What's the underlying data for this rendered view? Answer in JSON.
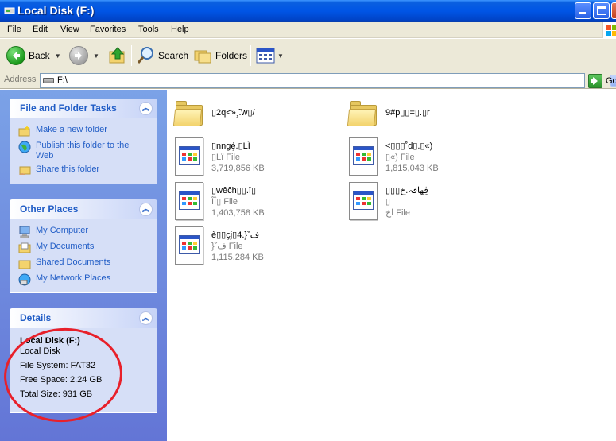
{
  "window": {
    "title": "Local Disk (F:)"
  },
  "menu": [
    "File",
    "Edit",
    "View",
    "Favorites",
    "Tools",
    "Help"
  ],
  "toolbar": {
    "back": "Back",
    "search": "Search",
    "folders": "Folders"
  },
  "address": {
    "label": "Address",
    "value": "F:\\",
    "go": "Go"
  },
  "taskpane": {
    "file_tasks": {
      "title": "File and Folder Tasks",
      "links": [
        {
          "label": "Make a new folder",
          "icon": "new-folder-icon"
        },
        {
          "label": "Publish this folder to the Web",
          "icon": "publish-web-icon"
        },
        {
          "label": "Share this folder",
          "icon": "share-folder-icon"
        }
      ]
    },
    "other_places": {
      "title": "Other Places",
      "links": [
        {
          "label": "My Computer",
          "icon": "my-computer-icon"
        },
        {
          "label": "My Documents",
          "icon": "my-documents-icon"
        },
        {
          "label": "Shared Documents",
          "icon": "shared-documents-icon"
        },
        {
          "label": "My Network Places",
          "icon": "network-places-icon"
        }
      ]
    },
    "details": {
      "title": "Details",
      "name": "Local Disk (F:)",
      "type": "Local Disk",
      "file_system": "File System: FAT32",
      "free_space": "Free Space: 2.24 GB",
      "total_size": "Total Size: 931 GB"
    }
  },
  "files": [
    {
      "kind": "folder",
      "name": "▯2q<»¸̃.w▯/"
    },
    {
      "kind": "folder",
      "name": "9#p▯▯=▯.▯r"
    },
    {
      "kind": "file",
      "name": "▯nngȩ́.▯LÏ",
      "type": "▯Lï File",
      "size": "3,719,856 KB"
    },
    {
      "kind": "file",
      "name": "<▯▯▯˚d▯.▯«)",
      "type": "▯«) File",
      "size": "1,815,043 KB"
    },
    {
      "kind": "file",
      "name": "▯wêĉh▯▯.î▯",
      "type": "ÎÎ▯ File",
      "size": "1,403,758 KB"
    },
    {
      "kind": "file",
      "name": "▯▯▯ڨِهاقہ.خ",
      "type": "▯",
      "size": "اخ File"
    },
    {
      "kind": "file",
      "name": "è▯▯çj▯4.}ˇف",
      "type": "}ˇف File",
      "size": "1,115,284 KB"
    }
  ],
  "colors": {
    "titlebar": "#0055e5",
    "taskpane": "#6f8fe0",
    "link": "#215dc6",
    "annotation": "#e8202a"
  }
}
